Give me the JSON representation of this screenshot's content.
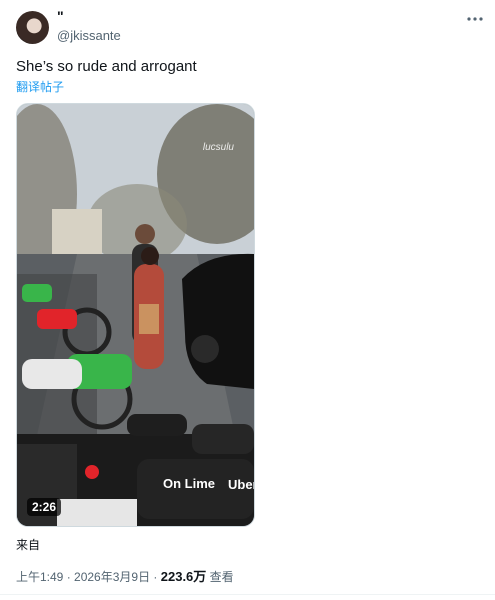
{
  "author": {
    "display_name": "\"",
    "handle": "@jkissante"
  },
  "tweet": {
    "text": "She’s so rude and arrogant",
    "translate_link": "翻译帖子"
  },
  "media": {
    "watermark": "lucsulu",
    "duration": "2:26",
    "bike_brand_1": "On Lime",
    "bike_brand_2": "Uber"
  },
  "source_label": "来自",
  "meta": {
    "time": "上午1:49",
    "sep1": " · ",
    "date": "2026年3月9日",
    "sep2": " · ",
    "views": "223.6万",
    "views_label": " 查看"
  },
  "icons": {
    "more": "more-horizontal-icon"
  }
}
